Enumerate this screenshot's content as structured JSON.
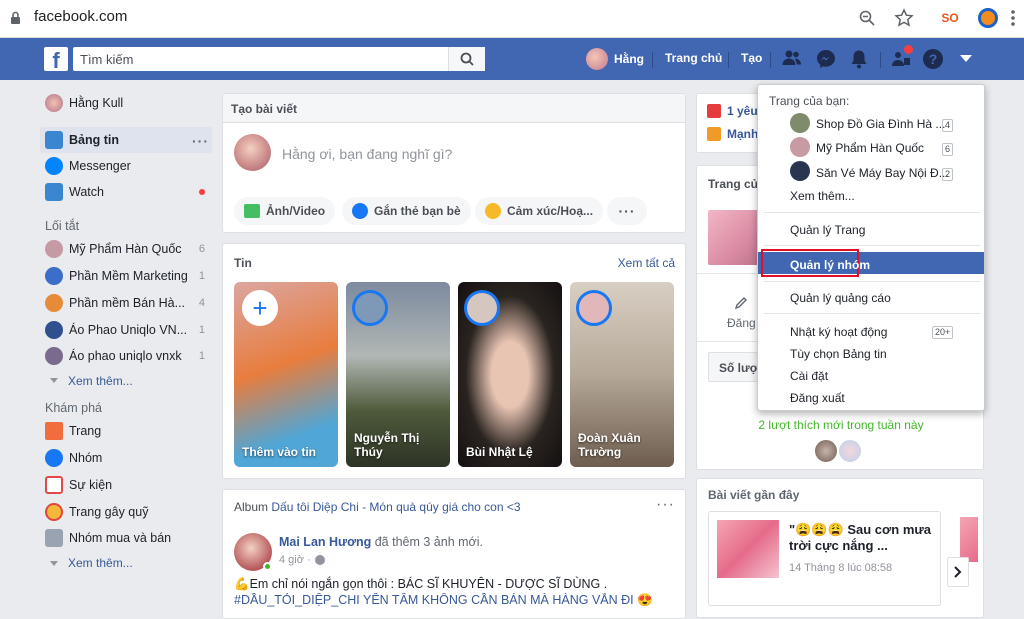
{
  "browser": {
    "url": "facebook.com"
  },
  "topbar": {
    "search_placeholder": "Tìm kiếm",
    "profile_name": "Hằng",
    "home": "Trang chủ",
    "create": "Tạo",
    "colors": {
      "bar": "#4267b2",
      "notif": "#fa3e3e"
    }
  },
  "left_nav": {
    "profile": "Hằng Kull",
    "main": [
      {
        "label": "Bảng tin",
        "icon": "newsfeed-icon"
      },
      {
        "label": "Messenger",
        "icon": "messenger-icon"
      },
      {
        "label": "Watch",
        "icon": "watch-icon"
      }
    ],
    "shortcuts_title": "Lối tắt",
    "shortcuts": [
      {
        "label": "Mỹ Phẩm Hàn Quốc",
        "count": "6"
      },
      {
        "label": "Phần Mềm Marketing",
        "count": "1"
      },
      {
        "label": "Phần mềm Bán Hà...",
        "count": "4"
      },
      {
        "label": "Áo Phao Uniqlo VN...",
        "count": "1"
      },
      {
        "label": "Áo phao uniqlo vnxk",
        "count": "1"
      }
    ],
    "see_more": "Xem thêm...",
    "explore_title": "Khám phá",
    "explore": [
      {
        "label": "Trang",
        "icon": "flag-icon"
      },
      {
        "label": "Nhóm",
        "icon": "groups-icon"
      },
      {
        "label": "Sự kiện",
        "icon": "calendar-icon"
      },
      {
        "label": "Trang gây quỹ",
        "icon": "fundraiser-icon"
      },
      {
        "label": "Nhóm mua và bán",
        "icon": "tag-icon"
      }
    ],
    "see_more2": "Xem thêm..."
  },
  "composer": {
    "title": "Tạo bài viết",
    "prompt": "Hằng ơi, bạn đang nghĩ gì?",
    "actions": [
      "Ảnh/Video",
      "Gắn thẻ bạn bè",
      "Cảm xúc/Hoạ..."
    ]
  },
  "stories": {
    "title": "Tin",
    "see_all": "Xem tất cả",
    "items": [
      {
        "name": "Thêm vào tin"
      },
      {
        "name": "Nguyễn Thị Thúy"
      },
      {
        "name": "Bùi Nhật Lệ"
      },
      {
        "name": "Đoàn Xuân Trường"
      }
    ]
  },
  "post": {
    "header_prefix": "Album",
    "header_link": "Dấu tôi Diệp Chi - Món quà qúy giá cho con <3",
    "author": "Mai Lan Hương",
    "action": "đã thêm 3 ảnh mới.",
    "time": "4 giờ ·",
    "text": "💪Em chỉ nói ngắn gọn thôi : BÁC SĨ KHUYÊN - DƯỢC SĨ DÙNG .",
    "text2": "#DẦU_TỎI_DIỆP_CHI YÊN TÂM KHÔNG CẦN BÁN MÀ HÀNG VẪN ĐI 😍"
  },
  "right": {
    "top1": "1 yêu",
    "top2": "Mạnh",
    "pages_title": "Trang củ",
    "edit_label": "Đăng",
    "so_luot": "Số lượt",
    "likes_week": "2 lượt thích mới trong tuần này",
    "recent_title": "Bài viết gần đây",
    "recent_post_title": "\"😩😩😩 Sau cơn mưa trời cực nắng ...",
    "recent_post_date": "14 Tháng 8 lúc 08:58"
  },
  "dropdown": {
    "your_pages": "Trang của bạn:",
    "pages": [
      {
        "name": "Shop Đồ Gia Đình Hà ...",
        "badge": "4"
      },
      {
        "name": "Mỹ Phẩm Hàn Quốc",
        "badge": "6"
      },
      {
        "name": "Săn Vé Máy Bay Nội Đ...",
        "badge": "2"
      }
    ],
    "see_more": "Xem thêm...",
    "manage_pages": "Quản lý Trang",
    "manage_groups": "Quản lý nhóm",
    "manage_ads": "Quản lý quảng cáo",
    "activity_log": "Nhật ký hoạt động",
    "activity_badge": "20+",
    "news_pref": "Tùy chọn Bảng tin",
    "settings": "Cài đặt",
    "logout": "Đăng xuất",
    "highlight_color": "#4267b2",
    "highlight_border": "#e0102a"
  }
}
